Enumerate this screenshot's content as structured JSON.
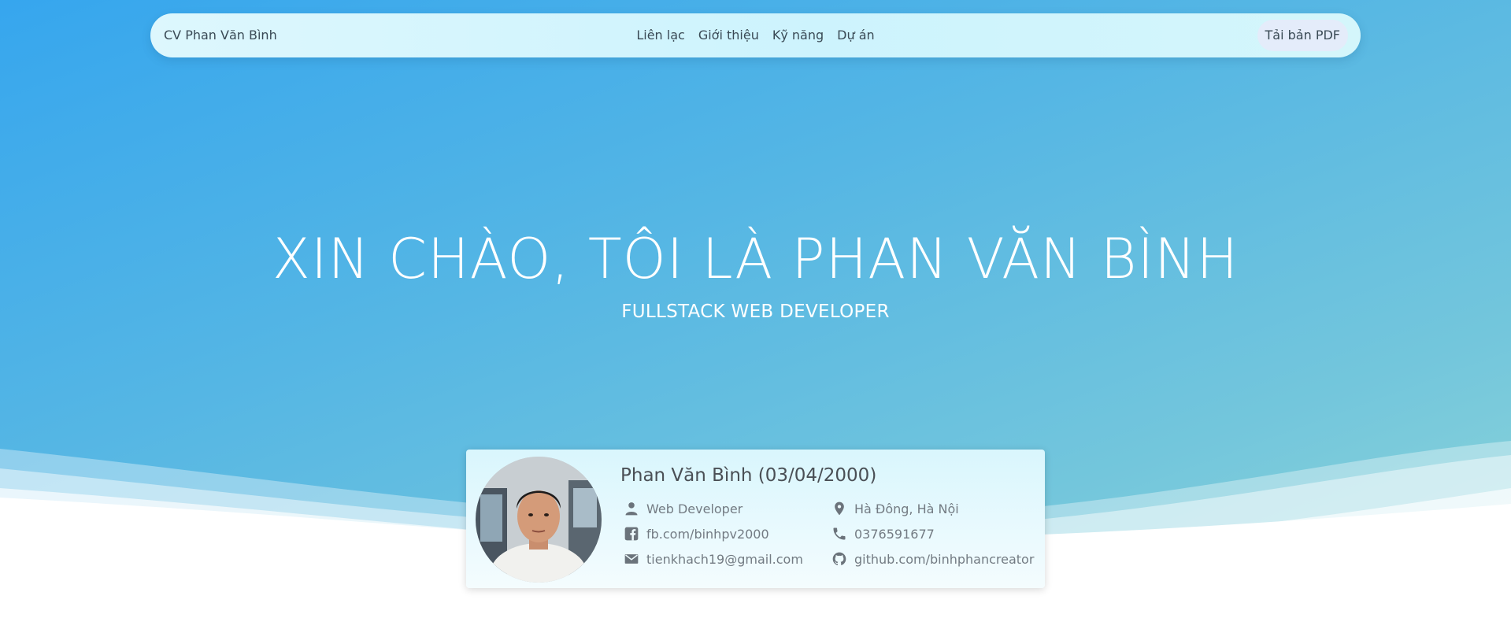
{
  "navbar": {
    "brand": "CV Phan Văn Bình",
    "links": [
      "Liên lạc",
      "Giới thiệu",
      "Kỹ năng",
      "Dự án"
    ],
    "pdf_button": "Tải bản PDF"
  },
  "hero": {
    "greeting": "XIN CHÀO, TÔI LÀ",
    "name_highlight": "PHAN VĂN BÌNH",
    "subtitle": "FULLSTACK WEB DEVELOPER"
  },
  "profile": {
    "name_dob": "Phan Văn Bình (03/04/2000)",
    "role": "Web Developer",
    "location": "Hà Đông, Hà Nội",
    "facebook": "fb.com/binhpv2000",
    "phone": "0376591677",
    "email": "tienkhach19@gmail.com",
    "github": "github.com/binhphancreator"
  },
  "icons": {
    "role": "person-icon",
    "location": "map-pin-icon",
    "facebook": "facebook-icon",
    "phone": "phone-icon",
    "email": "email-icon",
    "github": "github-icon"
  },
  "colors": {
    "hero_gradient_start": "#36a6ee",
    "hero_gradient_end": "#8fd6d8",
    "navbar_bg": "#cdf3fd",
    "icon_gray": "#6b737b"
  }
}
